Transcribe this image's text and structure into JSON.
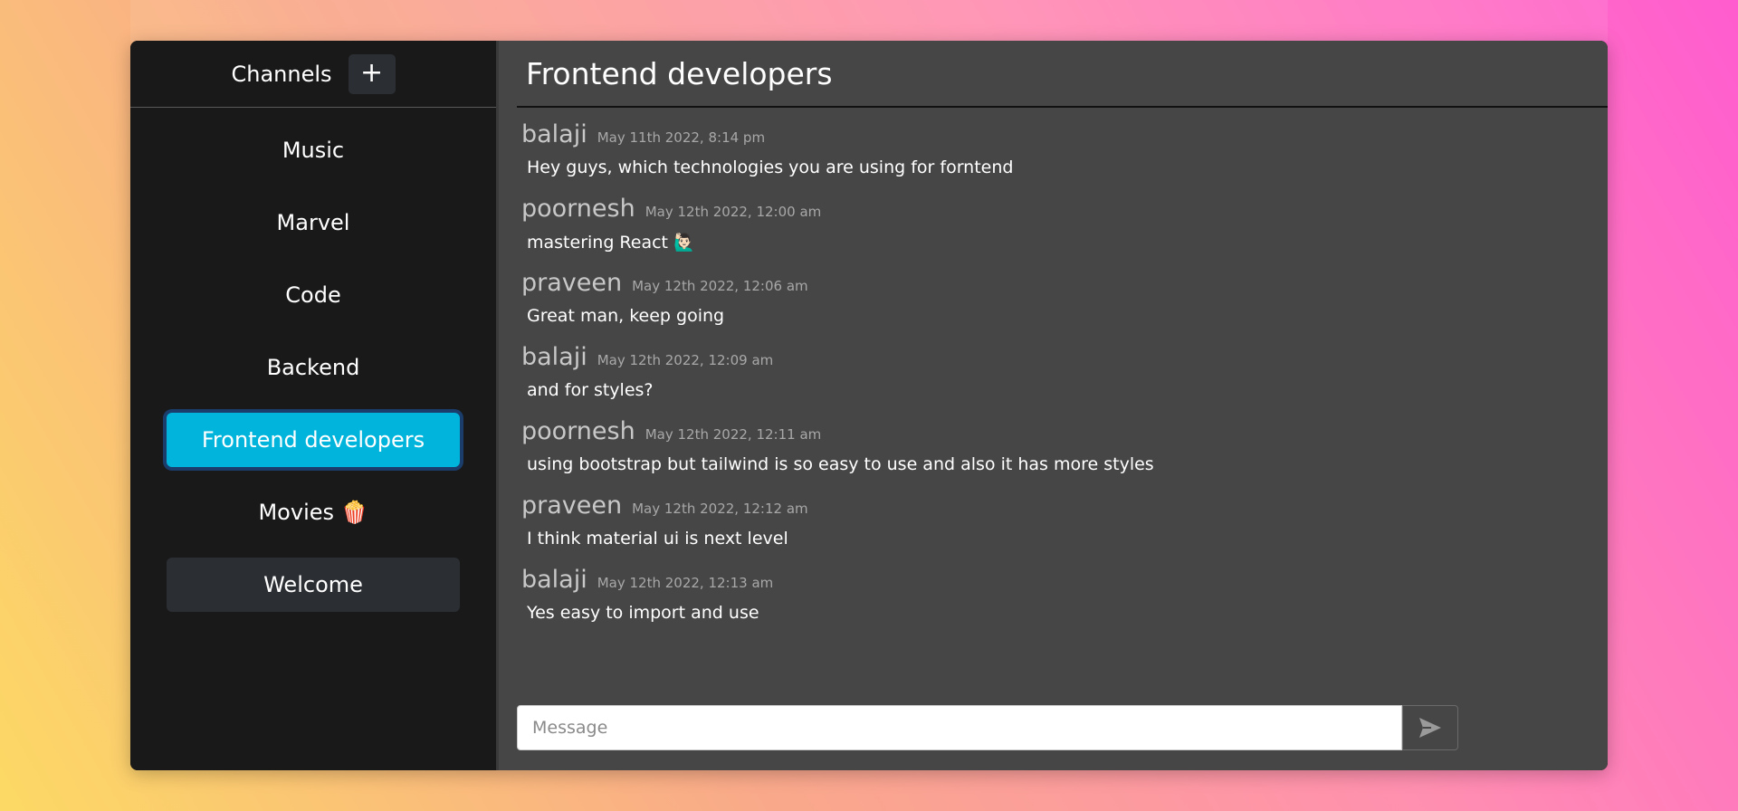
{
  "sidebar": {
    "title": "Channels",
    "add_label": "+",
    "channels": [
      {
        "label": "Music"
      },
      {
        "label": "Marvel"
      },
      {
        "label": "Code"
      },
      {
        "label": "Backend"
      },
      {
        "label": "Frontend developers"
      },
      {
        "label": "Movies 🍿"
      },
      {
        "label": "Welcome"
      }
    ]
  },
  "main": {
    "title": "Frontend developers",
    "messages": [
      {
        "author": "balaji",
        "time": "May 11th 2022, 8:14 pm",
        "text": "Hey guys, which technologies you are using for forntend"
      },
      {
        "author": "poornesh",
        "time": "May 12th 2022, 12:00 am",
        "text": "mastering React 🙋🏻‍♂️"
      },
      {
        "author": "praveen",
        "time": "May 12th 2022, 12:06 am",
        "text": "Great man, keep going"
      },
      {
        "author": "balaji",
        "time": "May 12th 2022, 12:09 am",
        "text": "and for styles?"
      },
      {
        "author": "poornesh",
        "time": "May 12th 2022, 12:11 am",
        "text": "using bootstrap but tailwind is so easy to use and also it has more styles"
      },
      {
        "author": "praveen",
        "time": "May 12th 2022, 12:12 am",
        "text": "I think material ui is next level"
      },
      {
        "author": "balaji",
        "time": "May 12th 2022, 12:13 am",
        "text": "Yes easy to import and use"
      }
    ]
  },
  "composer": {
    "placeholder": "Message",
    "value": "",
    "send_icon": "send-icon"
  },
  "colors": {
    "active_channel": "#00b4dc",
    "sidebar_bg": "#191919",
    "chat_bg": "#464646"
  }
}
